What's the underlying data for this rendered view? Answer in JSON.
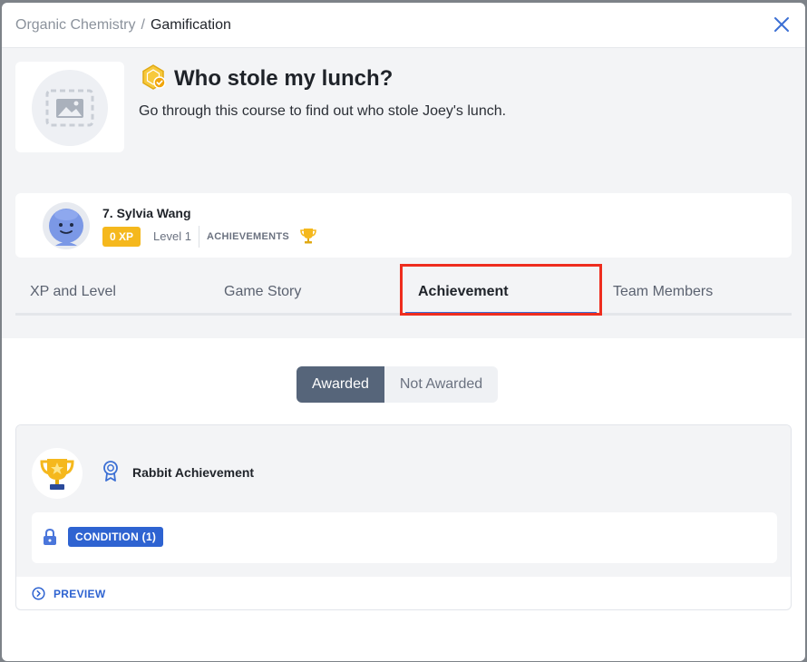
{
  "breadcrumb": {
    "root": "Organic Chemistry",
    "separator": "/",
    "current": "Gamification"
  },
  "course": {
    "title": "Who stole my lunch?",
    "description": "Go through this course to find out who stole Joey's lunch."
  },
  "profile": {
    "name": "7. Sylvia Wang",
    "xp": "0 XP",
    "level": "Level 1",
    "achievements_label": "ACHIEVEMENTS"
  },
  "tabs": [
    {
      "label": "XP and Level"
    },
    {
      "label": "Game Story"
    },
    {
      "label": "Achievement",
      "active": true
    },
    {
      "label": "Team Members"
    }
  ],
  "filter": {
    "awarded": "Awarded",
    "not_awarded": "Not Awarded",
    "selected": "Awarded"
  },
  "achievement": {
    "name": "Rabbit Achievement",
    "condition": "CONDITION (1)",
    "preview": "PREVIEW"
  },
  "colors": {
    "accent": "#3b6fd4",
    "xp_badge": "#f5b81d",
    "highlight": "#ee2d1e",
    "segment_active": "#56657a"
  },
  "icons": [
    "close-icon",
    "image-placeholder-icon",
    "course-badge-icon",
    "avatar-smiley-icon",
    "trophy-icon",
    "ribbon-icon",
    "lock-icon",
    "chevron-right-circle-icon"
  ]
}
